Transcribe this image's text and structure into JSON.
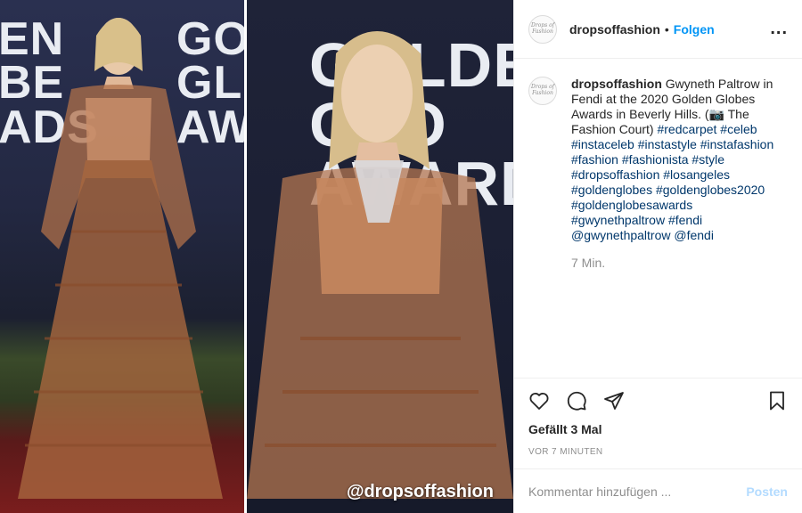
{
  "media": {
    "backdrop_left": [
      "EN",
      "BE",
      "ADS"
    ],
    "backdrop_left_right": [
      "GOL",
      "GLO",
      "AWA"
    ],
    "backdrop_right": [
      "GOLDEN",
      "GLO",
      "AWARDS"
    ],
    "watermark": "@dropsoffashion"
  },
  "header": {
    "avatar_text": "Drops of Fashion",
    "username": "dropsoffashion",
    "separator": "•",
    "follow_label": "Folgen",
    "more_label": "..."
  },
  "caption": {
    "avatar_text": "Drops of Fashion",
    "username": "dropsoffashion",
    "text": "Gwyneth Paltrow in Fendi at the 2020 Golden Globes Awards in Beverly Hills. (📷 The Fashion Court)",
    "tags": "#redcarpet #celeb #instaceleb #instastyle #instafashion #fashion #fashionista #style #dropsoffashion #losangeles #goldenglobes #goldenglobes2020 #goldenglobesawards #gwynethpaltrow #fendi @gwynethpaltrow @fendi",
    "time": "7 Min."
  },
  "actions": {
    "like_icon": "heart-icon",
    "comment_icon": "comment-icon",
    "share_icon": "paper-plane-icon",
    "save_icon": "bookmark-icon"
  },
  "likes": "Gefällt 3 Mal",
  "posted": "VOR 7 MINUTEN",
  "comment_box": {
    "placeholder": "Kommentar hinzufügen ...",
    "post_label": "Posten"
  },
  "colors": {
    "link": "#0095f6",
    "hashtag": "#00376b",
    "muted": "#8e8e8e",
    "post_disabled": "#b3dbff"
  }
}
